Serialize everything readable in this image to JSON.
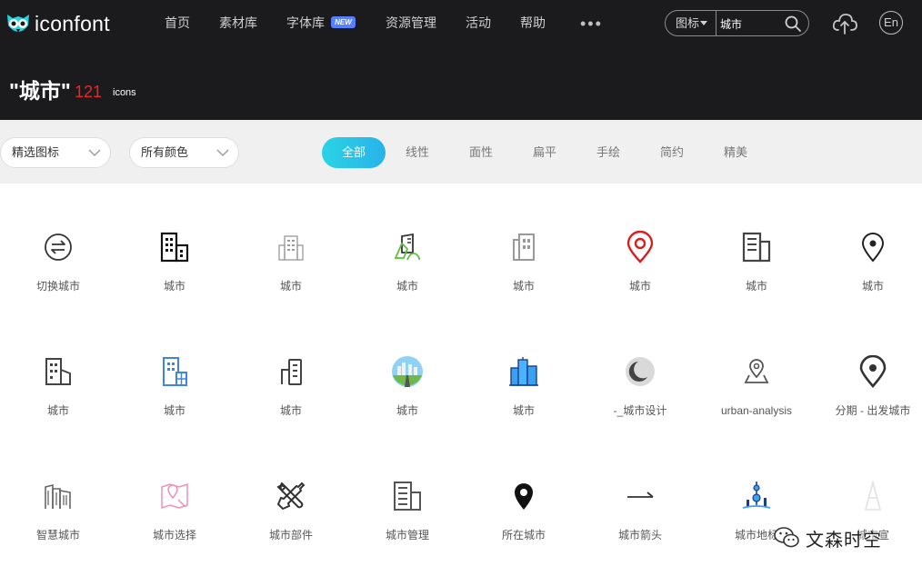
{
  "brand": {
    "name": "iconfont"
  },
  "nav": {
    "items": [
      "首页",
      "素材库",
      "字体库",
      "资源管理",
      "活动",
      "帮助"
    ],
    "new_badge": "NEW",
    "more": "•••"
  },
  "search": {
    "type_label": "图标",
    "value": "城市"
  },
  "lang": {
    "label": "En"
  },
  "result": {
    "query": "\"城市\"",
    "count": "121",
    "unit": "icons"
  },
  "filters": {
    "select1": "精选图标",
    "select2": "所有颜色",
    "tabs": [
      "全部",
      "线性",
      "面性",
      "扁平",
      "手绘",
      "简约",
      "精美"
    ],
    "active_tab": "全部"
  },
  "icons": [
    {
      "label": "切换城市",
      "icon": "switch-city-icon"
    },
    {
      "label": "城市",
      "icon": "buildings-outline-icon"
    },
    {
      "label": "城市",
      "icon": "apartment-gray-icon"
    },
    {
      "label": "城市",
      "icon": "city-green-icon"
    },
    {
      "label": "城市",
      "icon": "buildings-gray-icon"
    },
    {
      "label": "城市",
      "icon": "location-pin-red-icon"
    },
    {
      "label": "城市",
      "icon": "building-block-icon"
    },
    {
      "label": "城市",
      "icon": "location-pin-icon"
    },
    {
      "label": "城市",
      "icon": "building-small-icon"
    },
    {
      "label": "城市",
      "icon": "building-blue-icon"
    },
    {
      "label": "城市",
      "icon": "building-simple-icon"
    },
    {
      "label": "城市",
      "icon": "city-landscape-color-icon"
    },
    {
      "label": "城市",
      "icon": "skyscrapers-blue-icon"
    },
    {
      "label": "-_城市设计",
      "icon": "moon-badge-icon"
    },
    {
      "label": "urban-analysis",
      "icon": "map-pin-area-icon"
    },
    {
      "label": "分期 - 出发城市",
      "icon": "location-pin-dark-icon"
    },
    {
      "label": "智慧城市",
      "icon": "buildings-thin-icon"
    },
    {
      "label": "城市选择",
      "icon": "map-select-pink-icon"
    },
    {
      "label": "城市部件",
      "icon": "tools-icon"
    },
    {
      "label": "城市管理",
      "icon": "building-manage-icon"
    },
    {
      "label": "所在城市",
      "icon": "location-filled-icon"
    },
    {
      "label": "城市箭头",
      "icon": "arrow-right-icon"
    },
    {
      "label": "城市地标",
      "icon": "tower-landmark-icon"
    },
    {
      "label": "城市宣",
      "icon": "tower-faint-icon"
    }
  ],
  "watermark": {
    "text": "文森时空"
  },
  "colors": {
    "bar": "#1b1b1d",
    "accent": "#27b3ea",
    "count": "#e8272b",
    "new_badge": "#5580ff"
  }
}
